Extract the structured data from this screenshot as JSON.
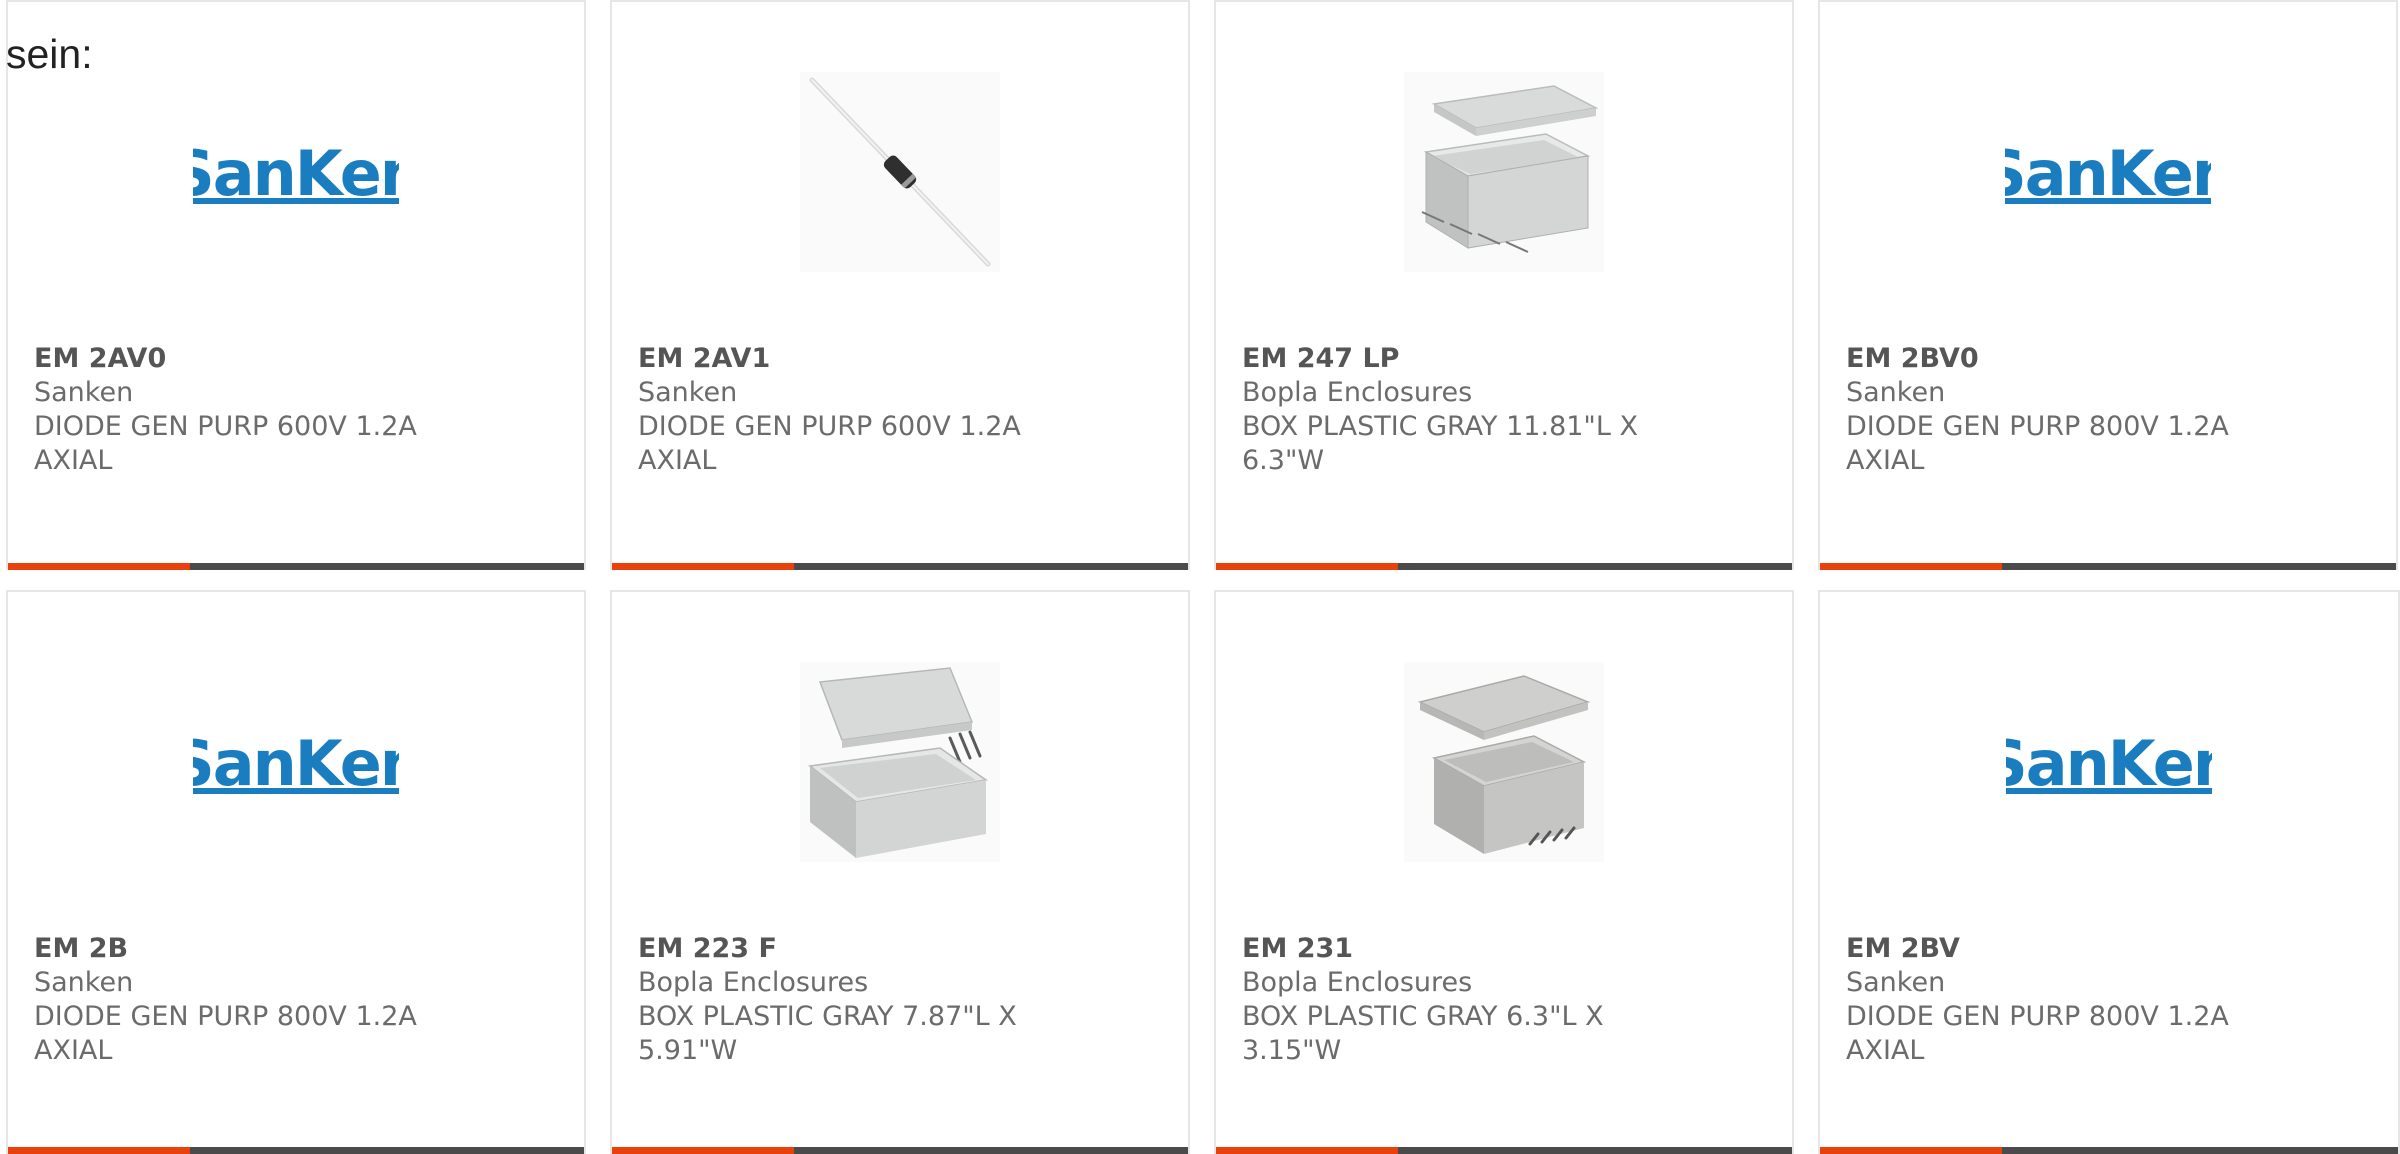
{
  "intro_text": "sein:",
  "colors": {
    "accent": "#e8410c",
    "bar": "#4a4a4a",
    "brand_blue": "#1a7dbf",
    "card_border": "#e6e6e6"
  },
  "products": [
    {
      "part_number": "EM 2AV0",
      "manufacturer": "Sanken",
      "description": "DIODE GEN PURP 600V 1.2A AXIAL",
      "image": "sanken-logo"
    },
    {
      "part_number": "EM 2AV1",
      "manufacturer": "Sanken",
      "description": "DIODE GEN PURP 600V 1.2A AXIAL",
      "image": "axial-diode"
    },
    {
      "part_number": "EM 247 LP",
      "manufacturer": "Bopla Enclosures",
      "description": "BOX PLASTIC GRAY 11.81\"L X 6.3\"W",
      "image": "plastic-enclosure"
    },
    {
      "part_number": "EM 2BV0",
      "manufacturer": "Sanken",
      "description": "DIODE GEN PURP 800V 1.2A AXIAL",
      "image": "sanken-logo"
    },
    {
      "part_number": "EM 2B",
      "manufacturer": "Sanken",
      "description": "DIODE GEN PURP 800V 1.2A AXIAL",
      "image": "sanken-logo"
    },
    {
      "part_number": "EM 223 F",
      "manufacturer": "Bopla Enclosures",
      "description": "BOX PLASTIC GRAY 7.87\"L X 5.91\"W",
      "image": "plastic-enclosure"
    },
    {
      "part_number": "EM 231",
      "manufacturer": "Bopla Enclosures",
      "description": "BOX PLASTIC GRAY 6.3\"L X 3.15\"W",
      "image": "plastic-enclosure"
    },
    {
      "part_number": "EM 2BV",
      "manufacturer": "Sanken",
      "description": "DIODE GEN PURP 800V 1.2A AXIAL",
      "image": "sanken-logo"
    }
  ]
}
